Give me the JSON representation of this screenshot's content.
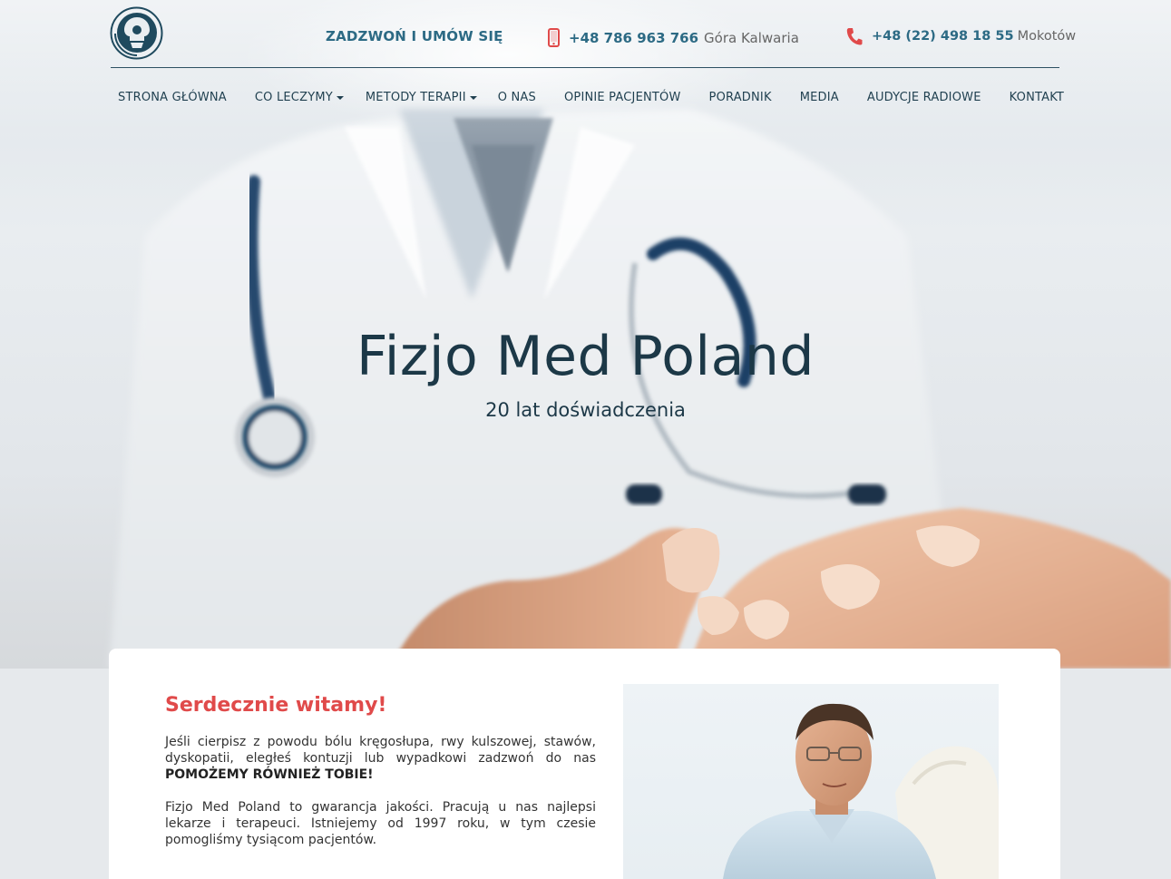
{
  "header": {
    "logo_icon": "spine-vertebra-logo-icon",
    "call_label": "ZADZWOŃ I UMÓW SIĘ",
    "phones": [
      {
        "number": "+48 786 963 766",
        "location": "Góra Kalwaria",
        "icon": "mobile-phone-icon"
      },
      {
        "number": "+48 (22) 498 18 55",
        "location": "Mokotów",
        "icon": "handset-icon"
      }
    ]
  },
  "nav": {
    "items": [
      {
        "label": "STRONA GŁÓWNA",
        "dropdown": false
      },
      {
        "label": "CO LECZYMY",
        "dropdown": true
      },
      {
        "label": "METODY TERAPII",
        "dropdown": true
      },
      {
        "label": "O NAS",
        "dropdown": false
      },
      {
        "label": "OPINIE PACJENTÓW",
        "dropdown": false
      },
      {
        "label": "PORADNIK",
        "dropdown": false
      },
      {
        "label": "MEDIA",
        "dropdown": false
      },
      {
        "label": "AUDYCJE RADIOWE",
        "dropdown": false
      },
      {
        "label": "KONTAKT",
        "dropdown": false
      }
    ]
  },
  "hero": {
    "title": "Fizjo Med Poland",
    "subtitle": "20 lat doświadczenia"
  },
  "welcome": {
    "title": "Serdecznie witamy!",
    "para1_text": "Jeśli cierpisz z powodu bólu kręgosłupa, rwy kulszowej, stawów, dyskopatii, eległeś kontuzji lub wypadkowi zadzwoń do nas",
    "para1_bold": "POMOŻEMY RÓWNIEŻ TOBIE!",
    "para2_text": "Fizjo Med Poland to gwarancja jakości. Pracują u nas najlepsi lekarze i terapeuci. Istniejemy od 1997 roku, w tym czesie pomogliśmy tysiącom pacjentów."
  },
  "colors": {
    "brand": "#2c6a84",
    "accent_red": "#e04a4a",
    "nav_text": "#1f3f4f"
  }
}
